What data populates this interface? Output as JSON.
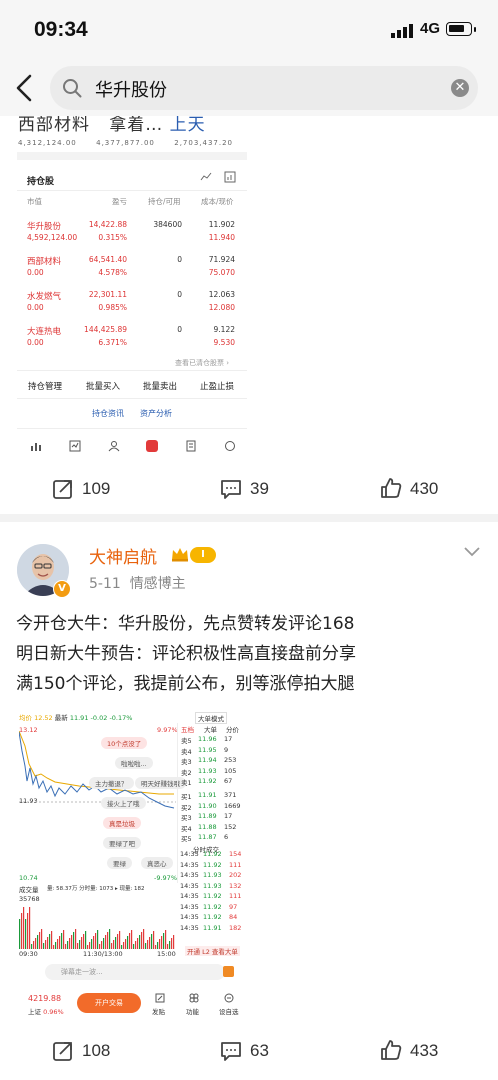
{
  "status_bar": {
    "time": "09:34",
    "network": "4G"
  },
  "search": {
    "query": "华升股份"
  },
  "card1": {
    "cut_title_left": "西部材料",
    "cut_title_mid": "拿着…",
    "cut_title_right": "上天",
    "cut_numbers": [
      "4,312,124.00",
      "4,377,877.00",
      "2,703,437.20"
    ],
    "holdings_title": "持仓股",
    "table_headers": [
      "市值",
      "盈亏",
      "持仓/可用",
      "成本/现价"
    ],
    "rows": [
      {
        "name": "华升股份",
        "value": "4,592,124.00",
        "pl": "14,422.88",
        "pl_pct": "0.315%",
        "qty": "384600",
        "cost": "11.902",
        "price": "11.940"
      },
      {
        "name": "西部材料",
        "value": "0.00",
        "pl": "64,541.40",
        "pl_pct": "4.578%",
        "qty": "0",
        "cost": "71.924",
        "price": "75.070"
      },
      {
        "name": "水发燃气",
        "value": "0.00",
        "pl": "22,301.11",
        "pl_pct": "0.985%",
        "qty": "0",
        "cost": "12.063",
        "price": "12.080"
      },
      {
        "name": "大连热电",
        "value": "0.00",
        "pl": "144,425.89",
        "pl_pct": "6.371%",
        "qty": "0",
        "cost": "9.122",
        "price": "9.530"
      }
    ],
    "cleared_link": "查看已清仓股票 ›",
    "actions": [
      "持仓管理",
      "批量买入",
      "批量卖出",
      "止盈止损"
    ],
    "sub_actions": [
      "持仓资讯",
      "资产分析"
    ],
    "stats": {
      "repost": "109",
      "comments": "39",
      "likes": "430"
    }
  },
  "card2": {
    "author": "大神启航",
    "level": "I",
    "verify": "V",
    "date": "5-11",
    "role": "情感博主",
    "post_lines": [
      "今开仓大牛：华升股份，先点赞转发评论168",
      "明日新大牛预告：评论积极性高直接盘前分享",
      "满150个评论，我提前公布，别等涨停拍大腿"
    ],
    "quote": {
      "label_price": "均价",
      "avg": "12.52",
      "new_label": "最新",
      "last": "11.91",
      "change": "-0.02",
      "change_pct": "-0.17%",
      "high": "13.12",
      "high_pct": "9.97%",
      "low": "10.74",
      "low_pct": "-9.97%",
      "mid_left": "11.93",
      "mode": "大单模式",
      "tabs": [
        "五档",
        "大单",
        "分价"
      ],
      "asks": [
        {
          "label": "卖5",
          "price": "11.96",
          "vol": "17"
        },
        {
          "label": "卖4",
          "price": "11.95",
          "vol": "9"
        },
        {
          "label": "卖3",
          "price": "11.94",
          "vol": "253"
        },
        {
          "label": "卖2",
          "price": "11.93",
          "vol": "105"
        },
        {
          "label": "卖1",
          "price": "11.92",
          "vol": "67"
        }
      ],
      "bids": [
        {
          "label": "买1",
          "price": "11.91",
          "vol": "371"
        },
        {
          "label": "买2",
          "price": "11.90",
          "vol": "1669"
        },
        {
          "label": "买3",
          "price": "11.89",
          "vol": "17"
        },
        {
          "label": "买4",
          "price": "11.88",
          "vol": "152"
        },
        {
          "label": "买5",
          "price": "11.87",
          "vol": "6"
        }
      ],
      "ticks_title": "分时成交",
      "ticks": [
        {
          "t": "14:35",
          "p": "11.92",
          "v": "154"
        },
        {
          "t": "14:35",
          "p": "11.92",
          "v": "111"
        },
        {
          "t": "14:35",
          "p": "11.93",
          "v": "202"
        },
        {
          "t": "14:35",
          "p": "11.93",
          "v": "132"
        },
        {
          "t": "14:35",
          "p": "11.92",
          "v": "111"
        },
        {
          "t": "14:35",
          "p": "11.92",
          "v": "97"
        },
        {
          "t": "14:35",
          "p": "11.92",
          "v": "84"
        },
        {
          "t": "14:35",
          "p": "11.91",
          "v": "182"
        }
      ],
      "vol_label": "成交量",
      "vol_info": "量: 58.37万 分时量: 1073 ▸ 现量: 182",
      "vol_max": "35768",
      "time_axis": [
        "09:30",
        "11:30/13:00",
        "15:00"
      ],
      "l2_tip": "开通 L2 查看大单",
      "bubbles": [
        "10个点没了",
        "啦啦啦...",
        "主力撤退？",
        "明天好赚钱哦",
        "接火上了哦",
        "真是垃圾",
        "要绿了吧",
        "要绿",
        "真恶心"
      ],
      "danmu_placeholder": "弹幕走一波...",
      "index_value": "4219.88",
      "index_name": "上证",
      "index_pct": "0.96%",
      "open_account": "开户交易",
      "nav": [
        "发贴",
        "功能",
        "设自选"
      ]
    },
    "stats": {
      "repost": "108",
      "comments": "63",
      "likes": "433"
    }
  }
}
